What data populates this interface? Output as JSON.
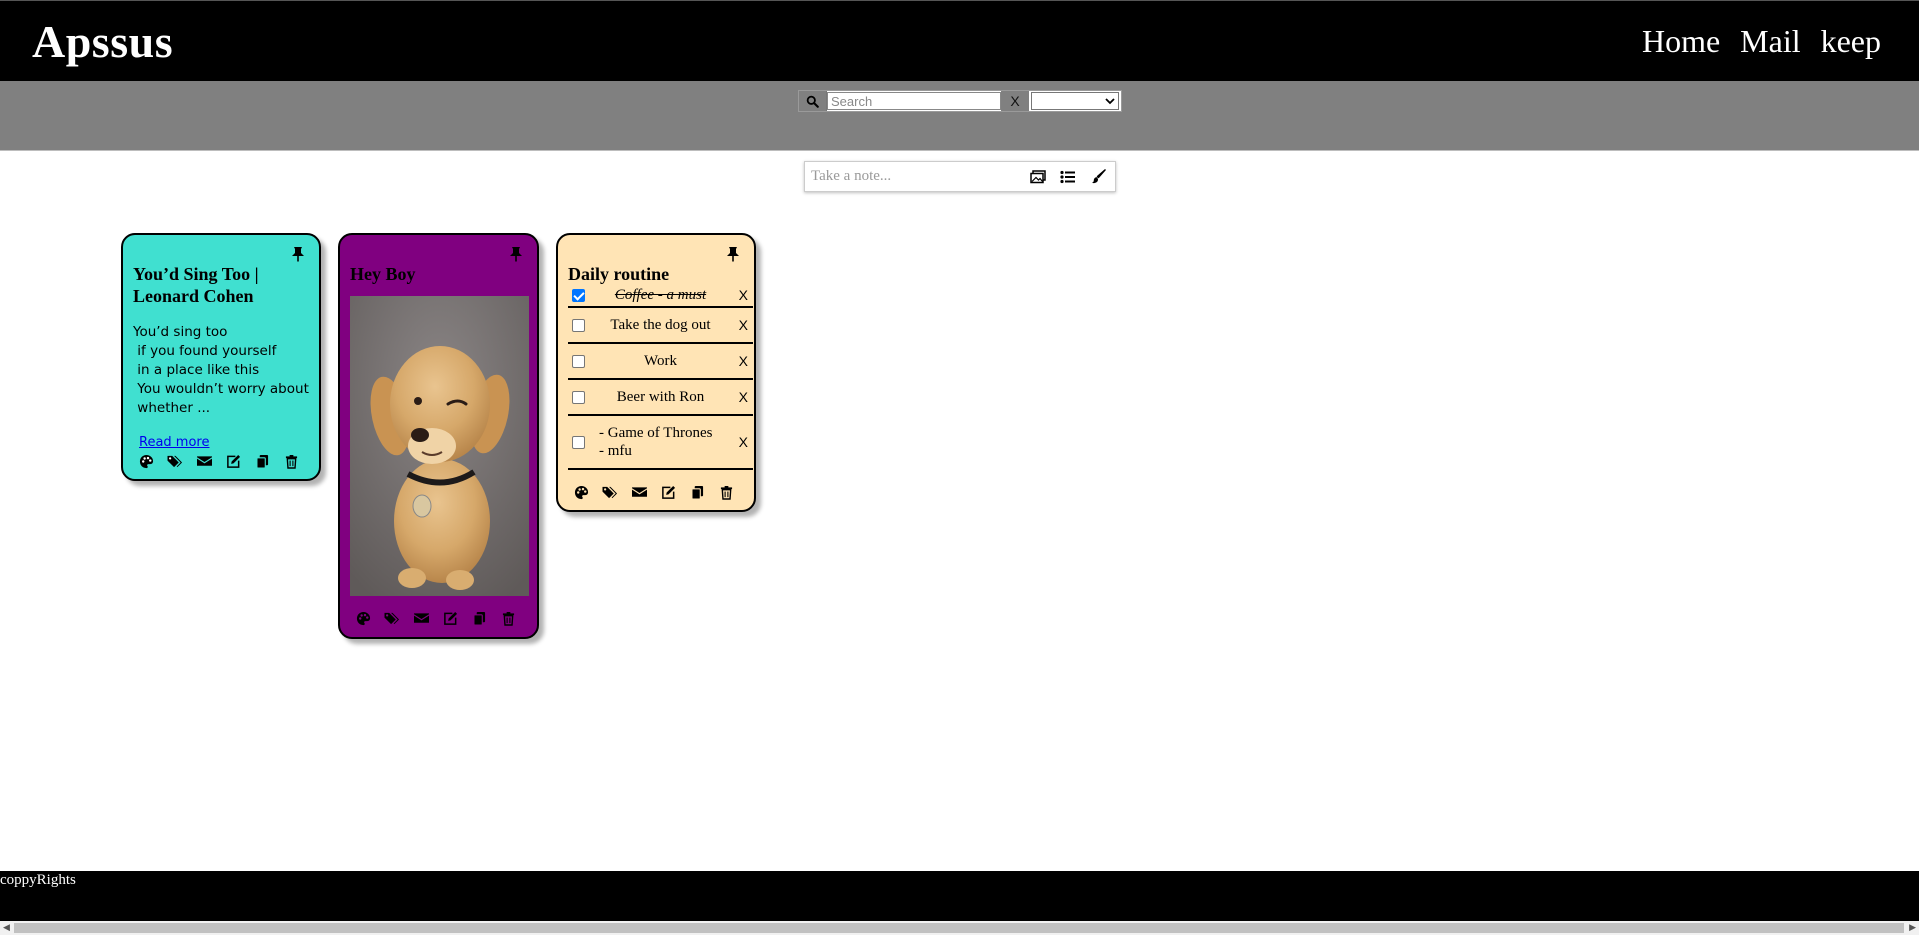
{
  "header": {
    "logo": "Apssus",
    "nav": [
      "Home",
      "Mail",
      "keep"
    ]
  },
  "filter": {
    "search_placeholder": "Search",
    "clear_label": "X",
    "select_value": ""
  },
  "composer": {
    "placeholder": "Take a note..."
  },
  "notes": [
    {
      "type": "text",
      "color": "#40e0d0",
      "pinned": true,
      "title": "You’d Sing Too |\nLeonard Cohen",
      "body": "You’d sing too\n if you found yourself\n in a place like this\n You wouldn’t worry about\n whether ...",
      "read_more": "Read more"
    },
    {
      "type": "image",
      "color": "#800080",
      "pinned": true,
      "title": "Hey Boy"
    },
    {
      "type": "todos",
      "color": "#ffe4b5",
      "pinned": true,
      "title": "Daily routine",
      "todos": [
        {
          "text": "Coffee - a must",
          "done": true
        },
        {
          "text": "Take the dog out",
          "done": false
        },
        {
          "text": "Work",
          "done": false
        },
        {
          "text": "Beer with Ron",
          "done": false
        },
        {
          "text": "- Game of Thrones\n- mfu",
          "done": false
        }
      ],
      "delete_label": "X"
    }
  ],
  "footer": {
    "text": "coppyRights"
  }
}
